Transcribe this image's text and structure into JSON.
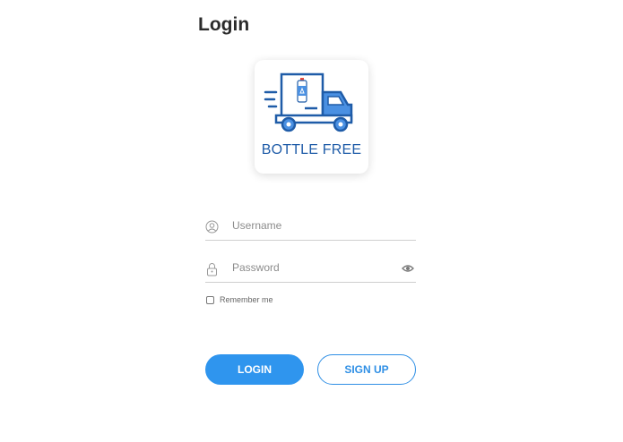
{
  "header": {
    "title": "Login"
  },
  "logo": {
    "text": "BOTTLE FREE",
    "color": "#1f5ca8",
    "accent": "#4a90e2"
  },
  "form": {
    "username": {
      "placeholder": "Username",
      "value": "",
      "icon": "user-circle-icon"
    },
    "password": {
      "placeholder": "Password",
      "value": "",
      "icon": "lock-icon",
      "toggle_icon": "eye-icon"
    },
    "remember": {
      "label": "Remember me",
      "checked": false
    }
  },
  "buttons": {
    "login": {
      "label": "LOGIN",
      "color": "#2f95ee"
    },
    "signup": {
      "label": "SIGN UP",
      "color": "#2f8fe5"
    }
  }
}
